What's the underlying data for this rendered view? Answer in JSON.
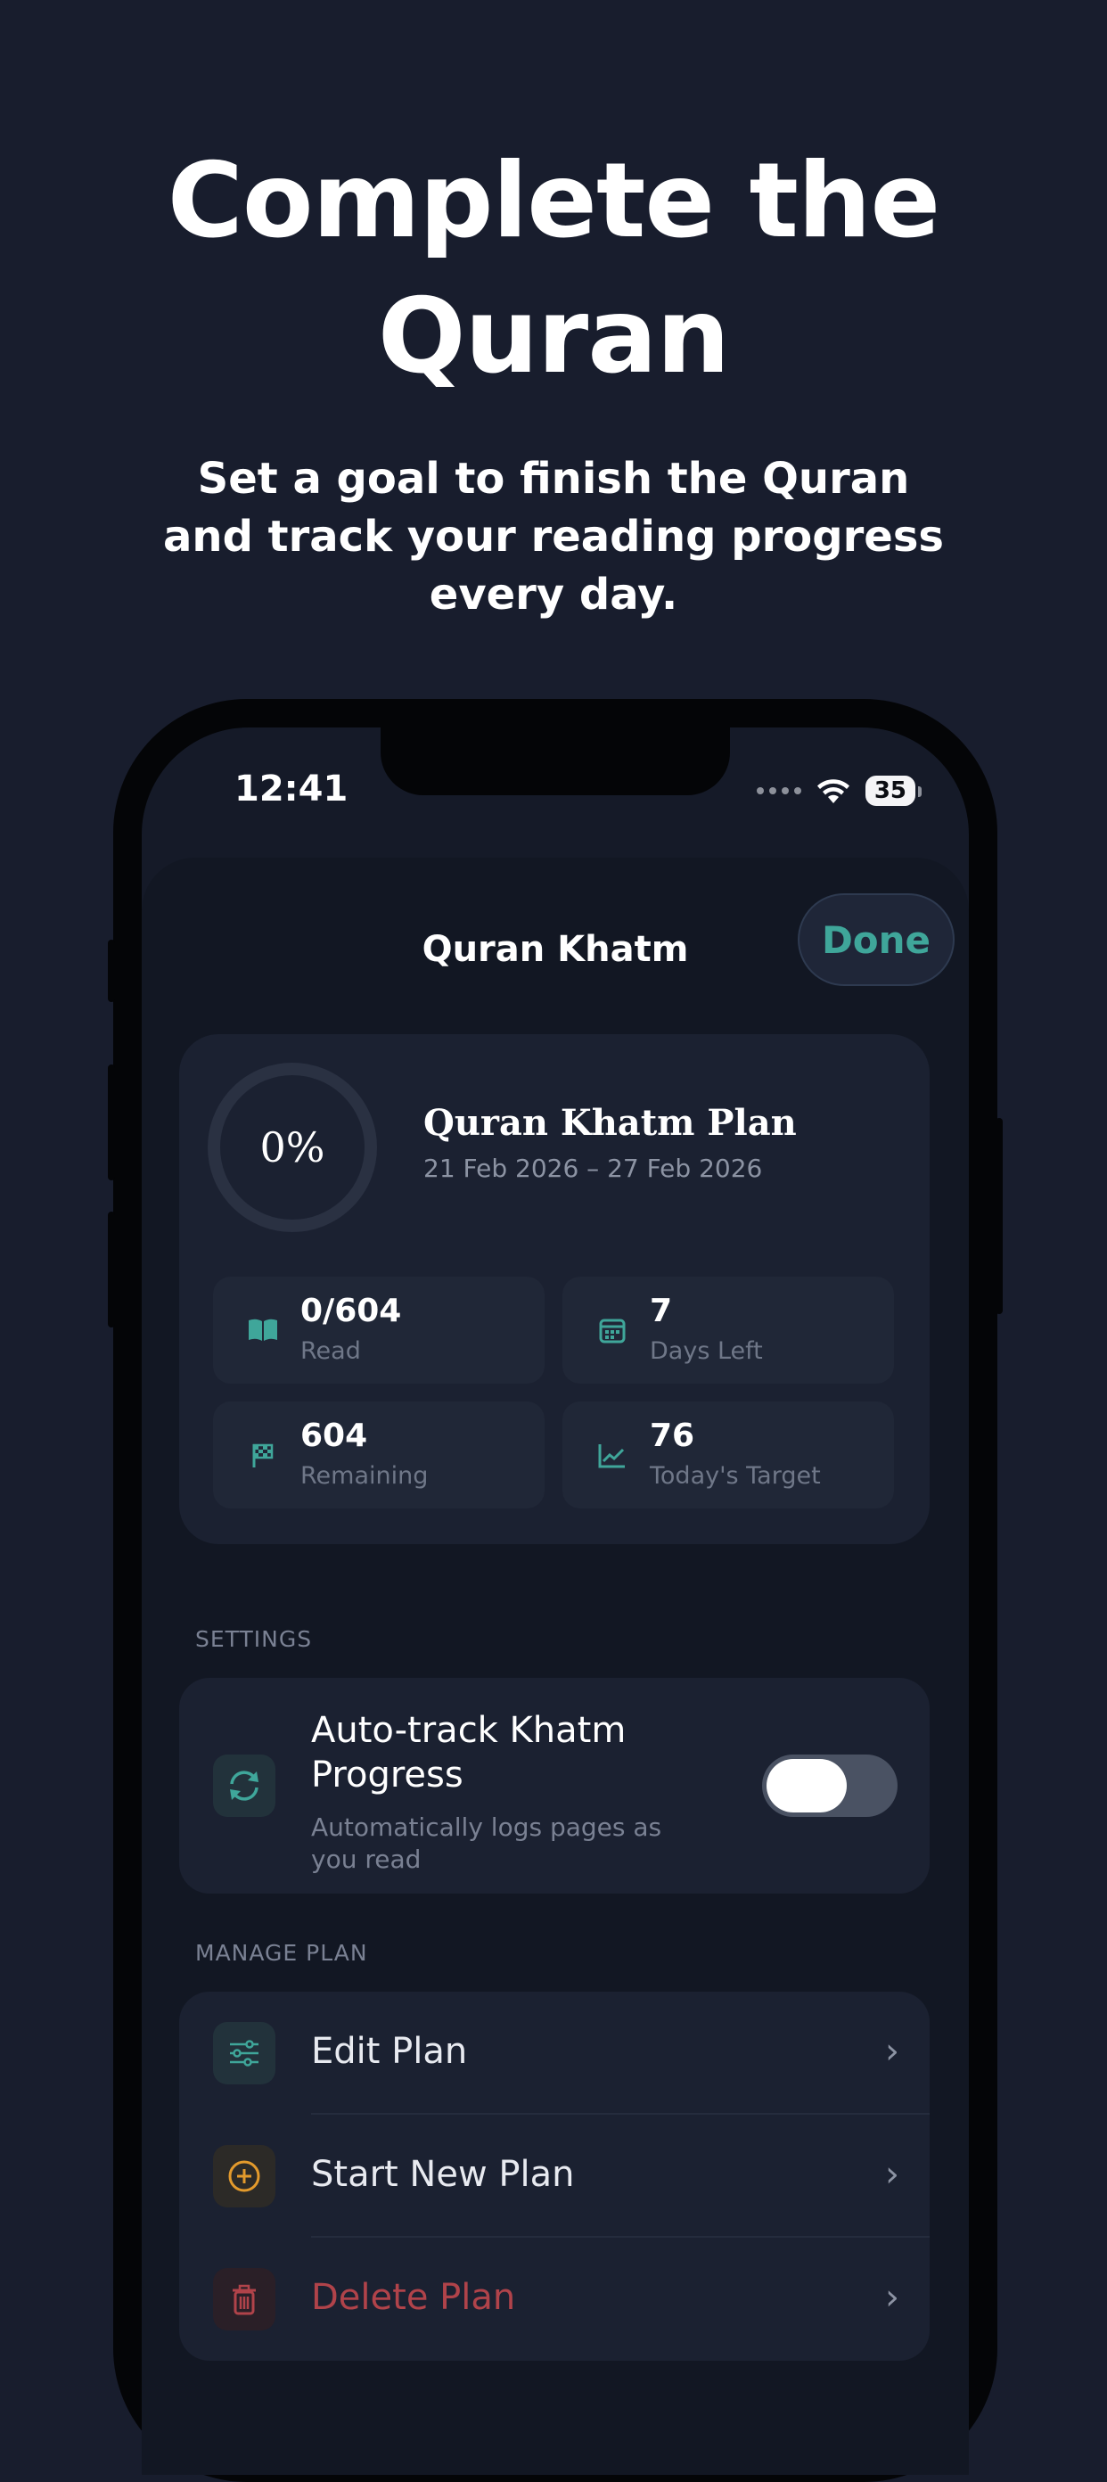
{
  "hero": {
    "title_line1": "Complete the",
    "title_line2": "Quran",
    "subtitle": "Set a goal to finish the Quran and track your reading progress every day."
  },
  "status_bar": {
    "time": "12:41",
    "battery": "35",
    "icons": [
      "signal-dots-icon",
      "wifi-icon",
      "battery-icon"
    ]
  },
  "sheet": {
    "title": "Quran Khatm",
    "done_label": "Done"
  },
  "plan": {
    "progress_label": "0%",
    "progress_fraction": 0,
    "name": "Quran Khatm Plan",
    "dates": "21 Feb 2026 – 27 Feb 2026",
    "stats": [
      {
        "value": "0/604",
        "label": "Read",
        "icon": "book-icon"
      },
      {
        "value": "7",
        "label": "Days Left",
        "icon": "calendar-icon"
      },
      {
        "value": "604",
        "label": "Remaining",
        "icon": "flag-icon"
      },
      {
        "value": "76",
        "label": "Today's Target",
        "icon": "trend-icon"
      }
    ]
  },
  "settings": {
    "section_label": "SETTINGS",
    "auto_track": {
      "title": "Auto-track Khatm Progress",
      "subtitle": "Automatically logs pages as you read",
      "enabled": false,
      "icon": "sync-icon"
    }
  },
  "manage": {
    "section_label": "MANAGE PLAN",
    "items": [
      {
        "label": "Edit Plan",
        "icon": "sliders-icon",
        "color": "#e8eaf0"
      },
      {
        "label": "Start New Plan",
        "icon": "plus-circle-icon",
        "color": "#e8eaf0"
      },
      {
        "label": "Delete Plan",
        "icon": "trash-icon",
        "color": "#b0434a"
      }
    ]
  },
  "colors": {
    "background": "#181d2d",
    "accent_teal": "#3fa69a",
    "accent_orange": "#e39a2c",
    "danger": "#b0434a"
  }
}
